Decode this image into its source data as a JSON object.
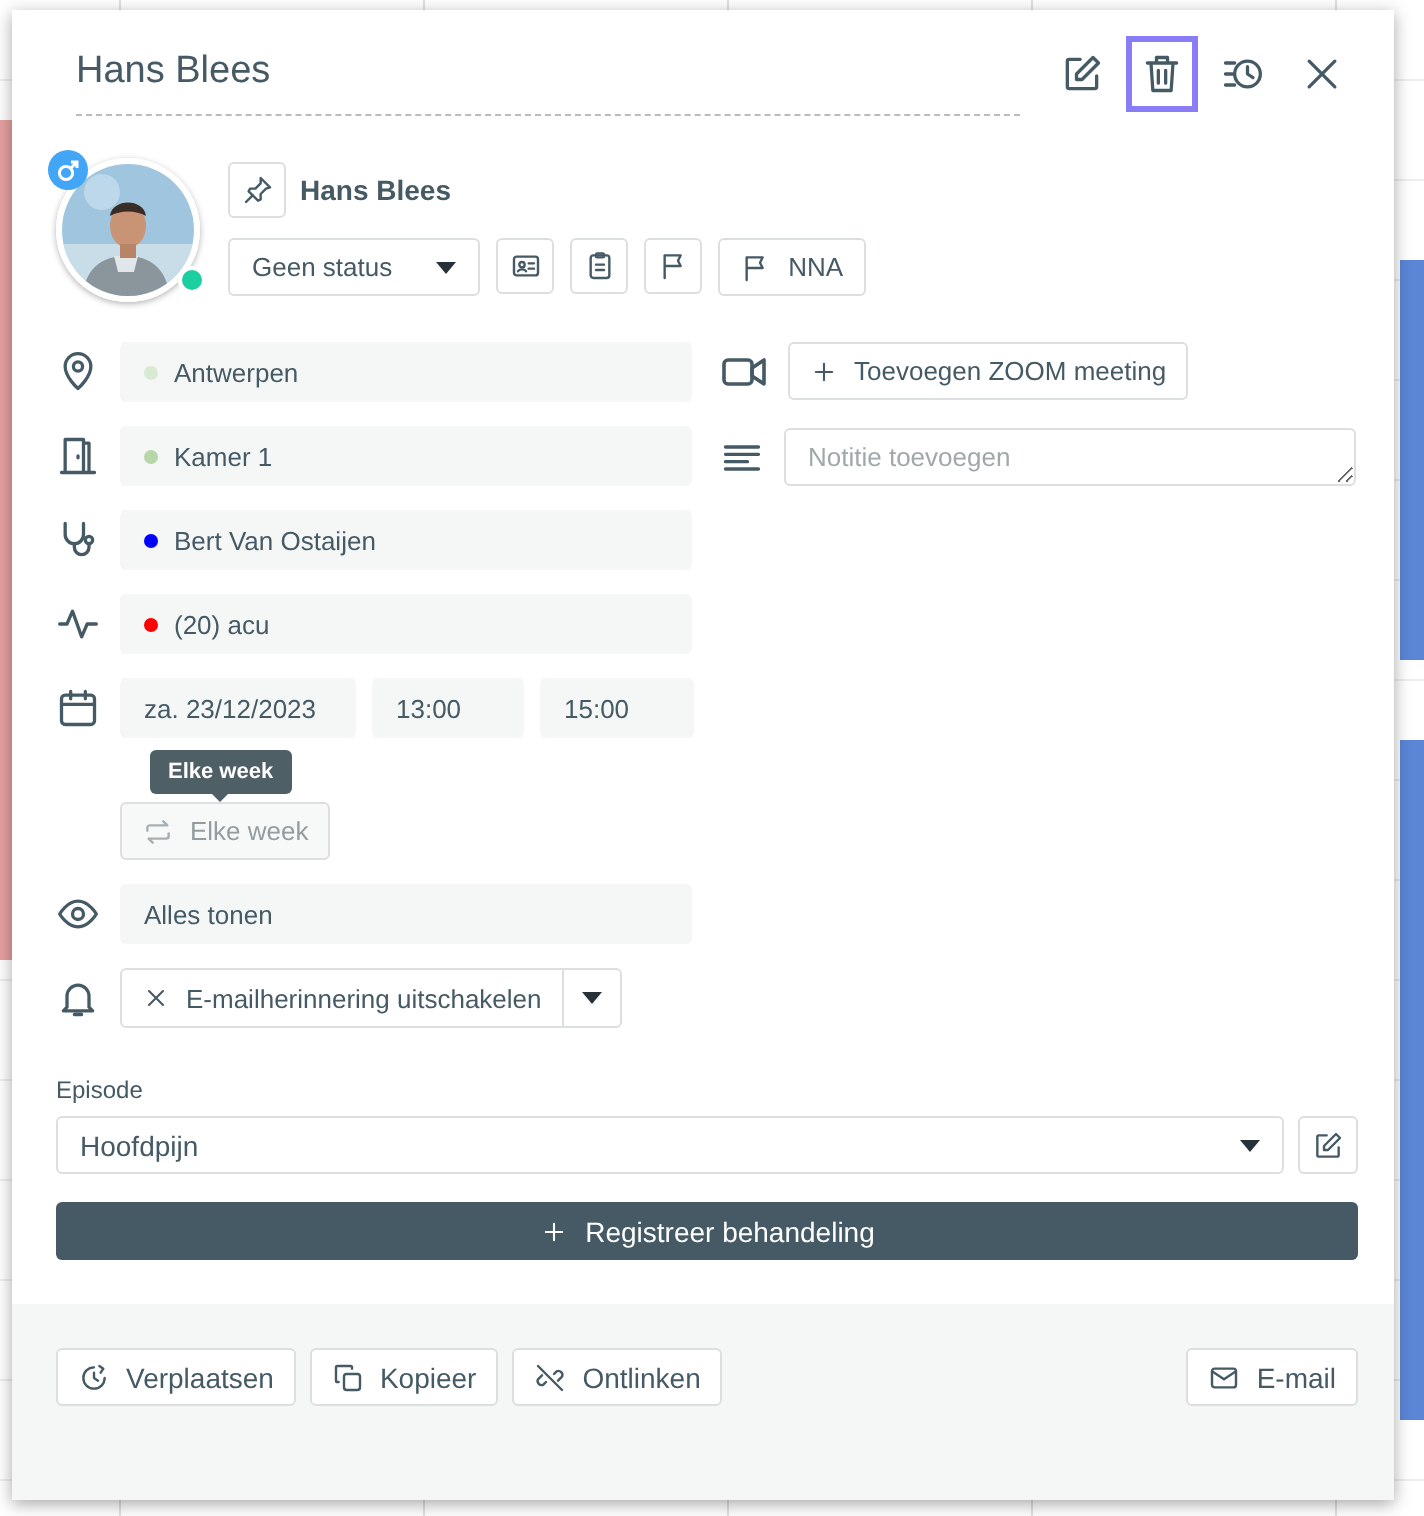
{
  "header": {
    "title": "Hans Blees",
    "actions": [
      {
        "kind": "edit",
        "selected": false
      },
      {
        "kind": "delete",
        "selected": true
      },
      {
        "kind": "history",
        "selected": false
      },
      {
        "kind": "close",
        "selected": false
      }
    ]
  },
  "patient": {
    "name": "Hans Blees",
    "online": true,
    "status": "Geen status",
    "tag_button": "NNA"
  },
  "fields": [
    {
      "kind": "location",
      "text": "Antwerpen",
      "color": "#d9ead3"
    },
    {
      "kind": "room",
      "text": "Kamer 1",
      "color": "#b6d7a8"
    },
    {
      "kind": "therapist",
      "text": "Bert Van Ostaijen",
      "color": "#0000ff"
    },
    {
      "kind": "treatment",
      "text": "(20) acu",
      "color": "#ff0000"
    }
  ],
  "schedule": {
    "date": "za. 23/12/2023",
    "start": "13:00",
    "end": "15:00",
    "tooltip": "Elke week",
    "repeat": {
      "label": "Elke week",
      "disabled": true
    }
  },
  "visibility": "Alles tonen",
  "reminder": "E-mailherinnering uitschakelen",
  "zoom_button": "Toevoegen ZOOM meeting",
  "note": {
    "placeholder": "Notitie toevoegen"
  },
  "episode": {
    "label": "Episode",
    "value": "Hoofdpijn"
  },
  "register_button": "Registreer behandeling",
  "footer": {
    "buttons": [
      {
        "kind": "move",
        "label": "Verplaatsen"
      },
      {
        "kind": "copy",
        "label": "Kopieer"
      },
      {
        "kind": "unlink",
        "label": "Ontlinken"
      }
    ],
    "email_button": "E-mail"
  }
}
